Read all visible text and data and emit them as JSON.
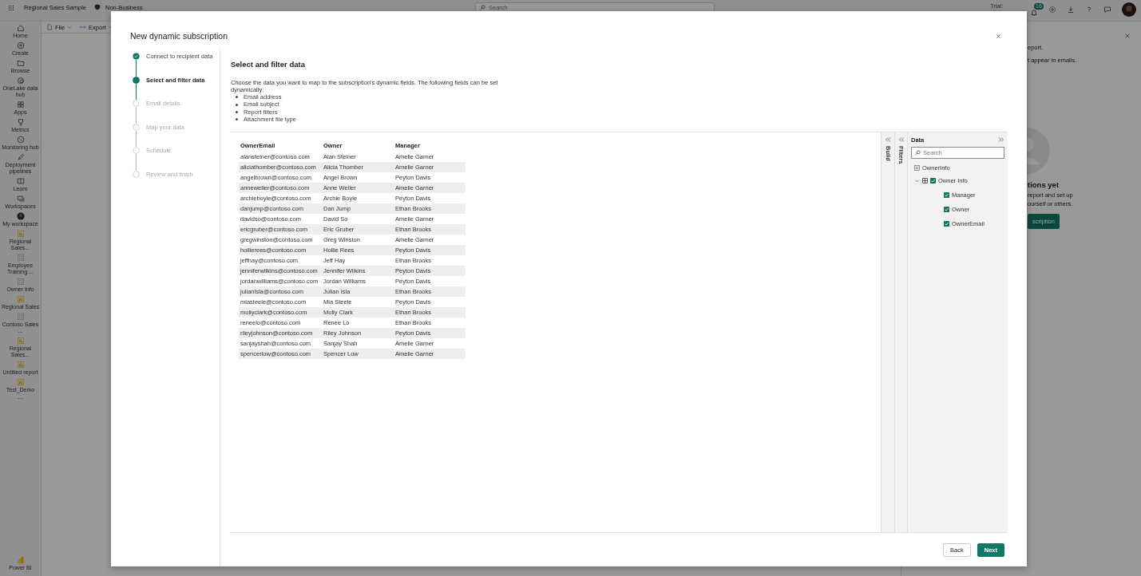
{
  "topbar": {
    "app_title": "Regional Sales Sample",
    "label": "Non-Business",
    "search": {
      "placeholder": "Search"
    },
    "trial": "Trial:",
    "notification_count": "16"
  },
  "nav": {
    "items": [
      {
        "label": "Home",
        "kind": "home"
      },
      {
        "label": "Create",
        "kind": "create"
      },
      {
        "label": "Browse",
        "kind": "browse"
      },
      {
        "label": "OneLake data hub",
        "kind": "hub"
      },
      {
        "label": "Apps",
        "kind": "apps"
      },
      {
        "label": "Metrics",
        "kind": "metrics"
      },
      {
        "label": "Monitoring hub",
        "kind": "monitor"
      },
      {
        "label": "Deployment pipelines",
        "kind": "deploy"
      },
      {
        "label": "Learn",
        "kind": "learn"
      },
      {
        "label": "Workspaces",
        "kind": "workspaces"
      },
      {
        "label": "My workspace",
        "kind": "avatar"
      },
      {
        "label": "Regional Sales...",
        "kind": "report"
      },
      {
        "label": "Employee Training ...",
        "kind": "model"
      },
      {
        "label": "Owner Info",
        "kind": "model"
      },
      {
        "label": "Regional Sales",
        "kind": "report"
      },
      {
        "label": "Contoso Sales ...",
        "kind": "model"
      },
      {
        "label": "Regional Sales...",
        "kind": "report"
      },
      {
        "label": "Untitled report",
        "kind": "report"
      },
      {
        "label": "Test_Demo",
        "kind": "report"
      }
    ],
    "more": "···",
    "brand": "Power BI"
  },
  "toolbar": {
    "items": [
      {
        "label": "File",
        "kind": "file"
      },
      {
        "label": "Export",
        "kind": "export"
      }
    ]
  },
  "side_panel": {
    "lines": [
      "eport.",
      "t appear in emails."
    ],
    "empty_title": "tions yet",
    "empty_text": [
      "report and set up",
      "ourself or others."
    ],
    "button": "scription"
  },
  "dialog": {
    "title": "New dynamic subscription",
    "steps": [
      {
        "label": "Connect to recipient data",
        "completed": true,
        "selected": false
      },
      {
        "label": "Select and filter data",
        "completed": false,
        "selected": true
      },
      {
        "label": "Email details",
        "completed": false,
        "selected": false
      },
      {
        "label": "Map your data",
        "completed": false,
        "selected": false
      },
      {
        "label": "Schedule",
        "completed": false,
        "selected": false
      },
      {
        "label": "Review and finish",
        "completed": false,
        "selected": false
      }
    ],
    "heading": "Select and filter data",
    "description": "Choose the data you want to map to the subscription's dynamic fields. The following fields can be set dynamically:",
    "fields": [
      "Email address",
      "Email subject",
      "Report filters",
      "Attachment file type"
    ],
    "table": {
      "columns": [
        "OwnerEmail",
        "Owner",
        "Manager"
      ],
      "rows": [
        [
          "alansteiner@contoso.com",
          "Alan Steiner",
          "Amelie Garner"
        ],
        [
          "aliciathomber@contoso.com",
          "Alicia Thomber",
          "Amelie Garner"
        ],
        [
          "angelbrown@contoso.com",
          "Angel Brown",
          "Peyton Davis"
        ],
        [
          "anneweiler@contoso.com",
          "Anne Weiler",
          "Amelie Garner"
        ],
        [
          "archieboyle@contoso.com",
          "Archie Boyle",
          "Peyton Davis"
        ],
        [
          "danjump@contoso.com",
          "Dan Jump",
          "Ethan Brooks"
        ],
        [
          "davidso@contoso.com",
          "David So",
          "Amelie Garner"
        ],
        [
          "ericgruber@contoso.com",
          "Eric Gruber",
          "Ethan Brooks"
        ],
        [
          "gregwinston@contoso.com",
          "Greg Winston",
          "Amelie Garner"
        ],
        [
          "hollierees@contoso.com",
          "Hollie Rees",
          "Peyton Davis"
        ],
        [
          "jeffhay@contoso.com",
          "Jeff Hay",
          "Ethan Brooks"
        ],
        [
          "jenniferwilkins@contoso.com",
          "Jennifer Wilkins",
          "Peyton Davis"
        ],
        [
          "jordanwilliams@contoso.com",
          "Jordan Williams",
          "Peyton Davis"
        ],
        [
          "julianisla@contoso.com",
          "Julian Isla",
          "Ethan Brooks"
        ],
        [
          "miasteele@contoso.com",
          "Mia Steele",
          "Peyton Davis"
        ],
        [
          "mollyclark@contoso.com",
          "Molly Clark",
          "Ethan Brooks"
        ],
        [
          "reneelo@contoso.com",
          "Renee Lo",
          "Ethan Brooks"
        ],
        [
          "rileyjohnson@contoso.com",
          "Riley Johnson",
          "Peyton Davis"
        ],
        [
          "sanjayshah@contoso.com",
          "Sanjay Shah",
          "Amelie Garner"
        ],
        [
          "spencerlow@contoso.com",
          "Spencer Low",
          "Amelie Garner"
        ]
      ]
    },
    "panes": {
      "build": "Build",
      "filters": "Filters",
      "data": {
        "title": "Data",
        "search": {
          "placeholder": "Search"
        },
        "tree": [
          {
            "label": "OwnerInfo",
            "kind": "table"
          },
          {
            "label": "Owner Info",
            "kind": "group",
            "expanded": true,
            "checked": true,
            "children": [
              {
                "label": "Manager",
                "checked": true
              },
              {
                "label": "Owner",
                "checked": true
              },
              {
                "label": "OwnerEmail",
                "checked": true
              }
            ]
          }
        ]
      }
    },
    "buttons": [
      {
        "label": "Back",
        "kind": "secondary"
      },
      {
        "label": "Next",
        "kind": "primary"
      }
    ]
  }
}
